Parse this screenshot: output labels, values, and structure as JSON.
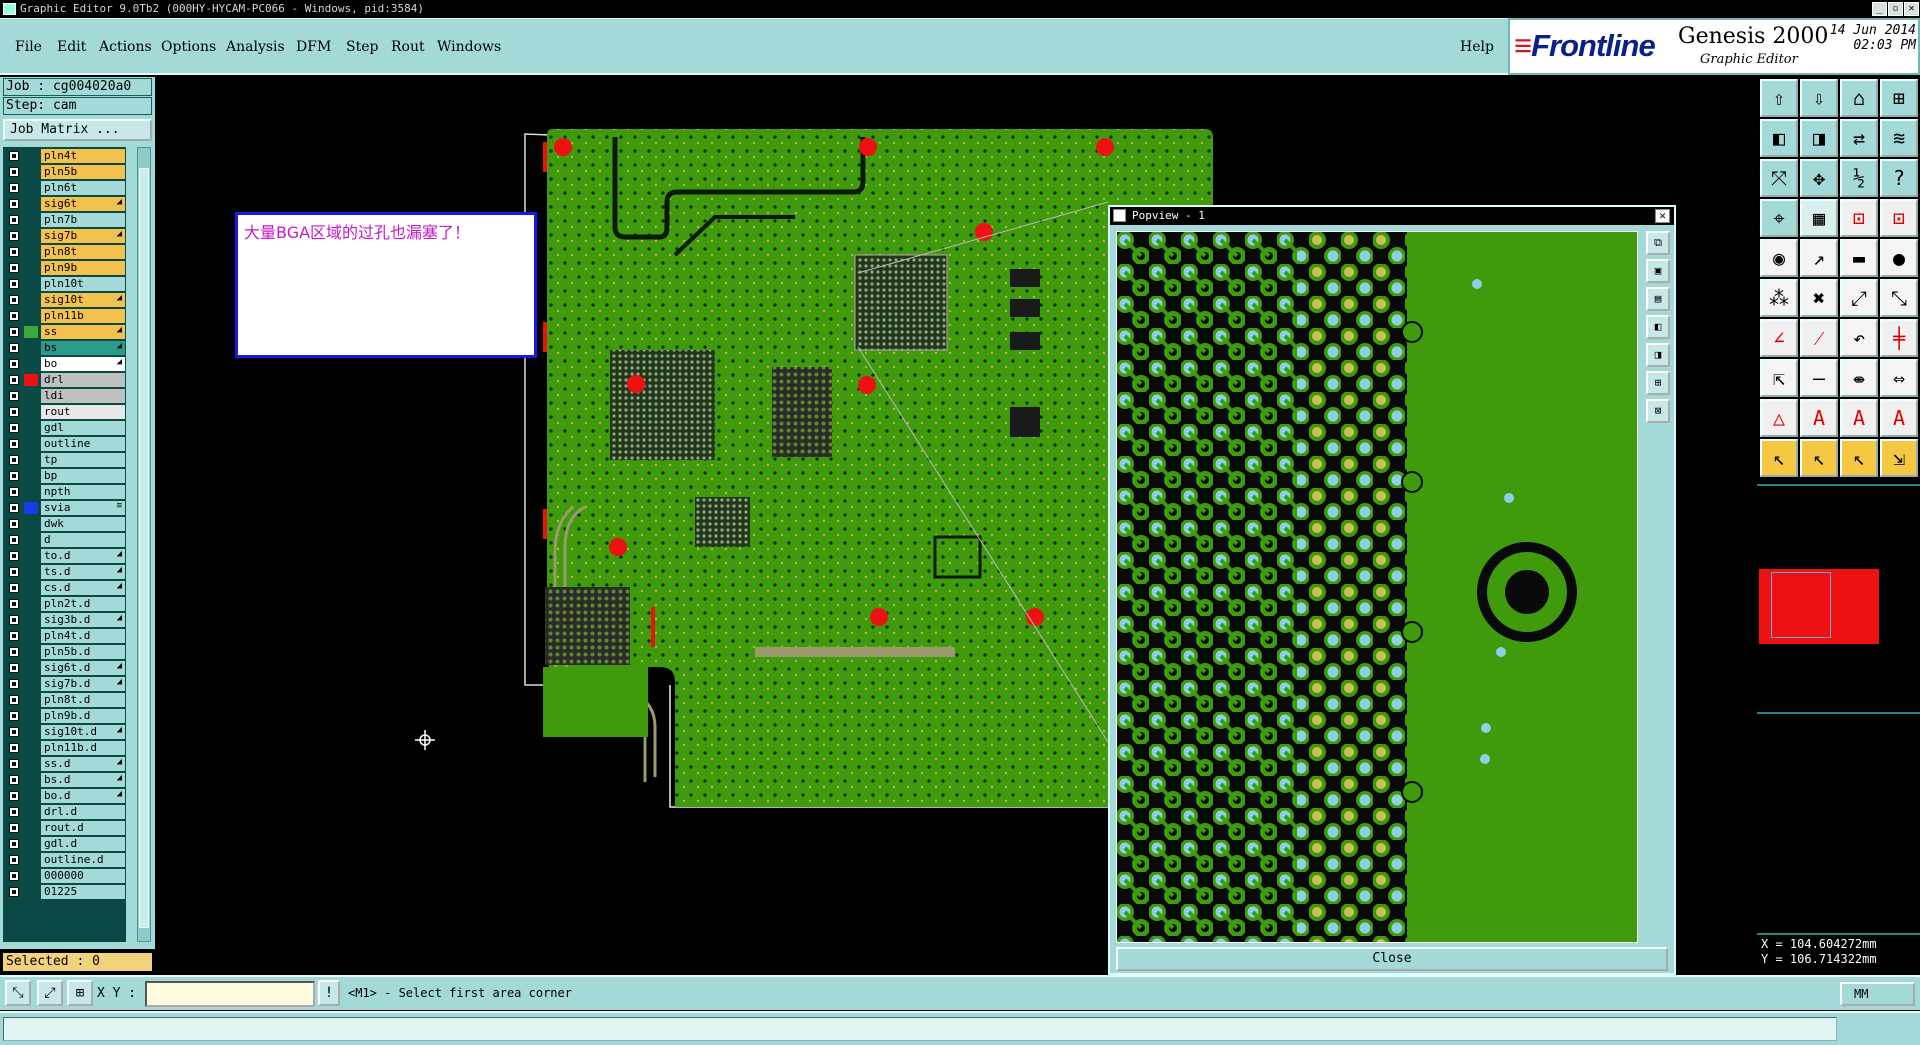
{
  "window": {
    "title": "Graphic Editor 9.0Tb2 (000HY-HYCAM-PC066 - Windows, pid:3584)"
  },
  "menu": {
    "items": [
      "File",
      "Edit",
      "Actions",
      "Options",
      "Analysis",
      "DFM",
      "Step",
      "Rout",
      "Windows"
    ],
    "help": "Help"
  },
  "brand": {
    "logo": "Frontline",
    "product": "Genesis 2000",
    "subtitle": "Graphic Editor",
    "date": "14 Jun 2014",
    "time": "02:03 PM"
  },
  "job": {
    "job_label": "Job : cg004020a0",
    "step_label": "Step: cam",
    "matrix_button": "Job Matrix ..."
  },
  "layers": [
    {
      "name": "pln4t",
      "color": "#f2c14e"
    },
    {
      "name": "pln5b",
      "color": "#f2c14e"
    },
    {
      "name": "pln6t",
      "color": "#a3d9d6"
    },
    {
      "name": "sig6t",
      "color": "#f2c14e",
      "mark": "◢"
    },
    {
      "name": "pln7b",
      "color": "#a3d9d6"
    },
    {
      "name": "sig7b",
      "color": "#f2c14e",
      "mark": "◢"
    },
    {
      "name": "pln8t",
      "color": "#f2c14e"
    },
    {
      "name": "pln9b",
      "color": "#f2c14e"
    },
    {
      "name": "pln10t",
      "color": "#a3d9d6"
    },
    {
      "name": "sig10t",
      "color": "#f2c14e",
      "mark": "◢"
    },
    {
      "name": "pln11b",
      "color": "#f2c14e"
    },
    {
      "name": "ss",
      "color": "#f2c14e",
      "swatch": "#3aa83a",
      "mark": "◢"
    },
    {
      "name": "bs",
      "color": "#2a9a8a",
      "mark": "◢"
    },
    {
      "name": "bo",
      "color": "#ffffff",
      "mark": "◢"
    },
    {
      "name": "drl",
      "color": "#c0c0c0",
      "swatch": "#ee1111"
    },
    {
      "name": "ldi",
      "color": "#c0c0c0"
    },
    {
      "name": "rout",
      "color": "#e8e8e8"
    },
    {
      "name": "gdl",
      "color": "#a3d9d6"
    },
    {
      "name": "outline",
      "color": "#a3d9d6"
    },
    {
      "name": "tp",
      "color": "#a3d9d6"
    },
    {
      "name": "bp",
      "color": "#a3d9d6"
    },
    {
      "name": "npth",
      "color": "#a3d9d6"
    },
    {
      "name": "svia",
      "color": "#a3d9d6",
      "swatch": "#1a3ae6",
      "mark": "≡"
    },
    {
      "name": "dwk",
      "color": "#a3d9d6"
    },
    {
      "name": "d",
      "color": "#a3d9d6"
    },
    {
      "name": "to.d",
      "color": "#a3d9d6",
      "mark": "◢"
    },
    {
      "name": "ts.d",
      "color": "#a3d9d6",
      "mark": "◢"
    },
    {
      "name": "cs.d",
      "color": "#a3d9d6",
      "mark": "◢"
    },
    {
      "name": "pln2t.d",
      "color": "#a3d9d6"
    },
    {
      "name": "sig3b.d",
      "color": "#a3d9d6",
      "mark": "◢"
    },
    {
      "name": "pln4t.d",
      "color": "#a3d9d6"
    },
    {
      "name": "pln5b.d",
      "color": "#a3d9d6"
    },
    {
      "name": "sig6t.d",
      "color": "#a3d9d6",
      "mark": "◢"
    },
    {
      "name": "sig7b.d",
      "color": "#a3d9d6",
      "mark": "◢"
    },
    {
      "name": "pln8t.d",
      "color": "#a3d9d6"
    },
    {
      "name": "pln9b.d",
      "color": "#a3d9d6"
    },
    {
      "name": "sig10t.d",
      "color": "#a3d9d6",
      "mark": "◢"
    },
    {
      "name": "pln11b.d",
      "color": "#a3d9d6"
    },
    {
      "name": "ss.d",
      "color": "#a3d9d6",
      "mark": "◢"
    },
    {
      "name": "bs.d",
      "color": "#a3d9d6",
      "mark": "◢"
    },
    {
      "name": "bo.d",
      "color": "#a3d9d6",
      "mark": "◢"
    },
    {
      "name": "drl.d",
      "color": "#a3d9d6"
    },
    {
      "name": "rout.d",
      "color": "#a3d9d6"
    },
    {
      "name": "gdl.d",
      "color": "#a3d9d6"
    },
    {
      "name": "outline.d",
      "color": "#a3d9d6"
    },
    {
      "name": "000000",
      "color": "#a3d9d6"
    },
    {
      "name": "01225",
      "color": "#a3d9d6"
    }
  ],
  "selected": "Selected : 0",
  "annotation": "大量BGA区域的过孔也漏塞了！",
  "popview": {
    "title": "Popview - 1",
    "close_label": "Close"
  },
  "coords": {
    "x": "X  = 104.604272mm",
    "y": "Y  = 106.714322mm"
  },
  "status": {
    "xy_label": "X Y :",
    "message": "<M1> - Select first area corner",
    "units": "MM"
  },
  "colors": {
    "panel": "#a3d9d6",
    "board_green": "#3f9a0c",
    "pad_red": "#ee1111",
    "via_blue": "#8fd0e8"
  }
}
